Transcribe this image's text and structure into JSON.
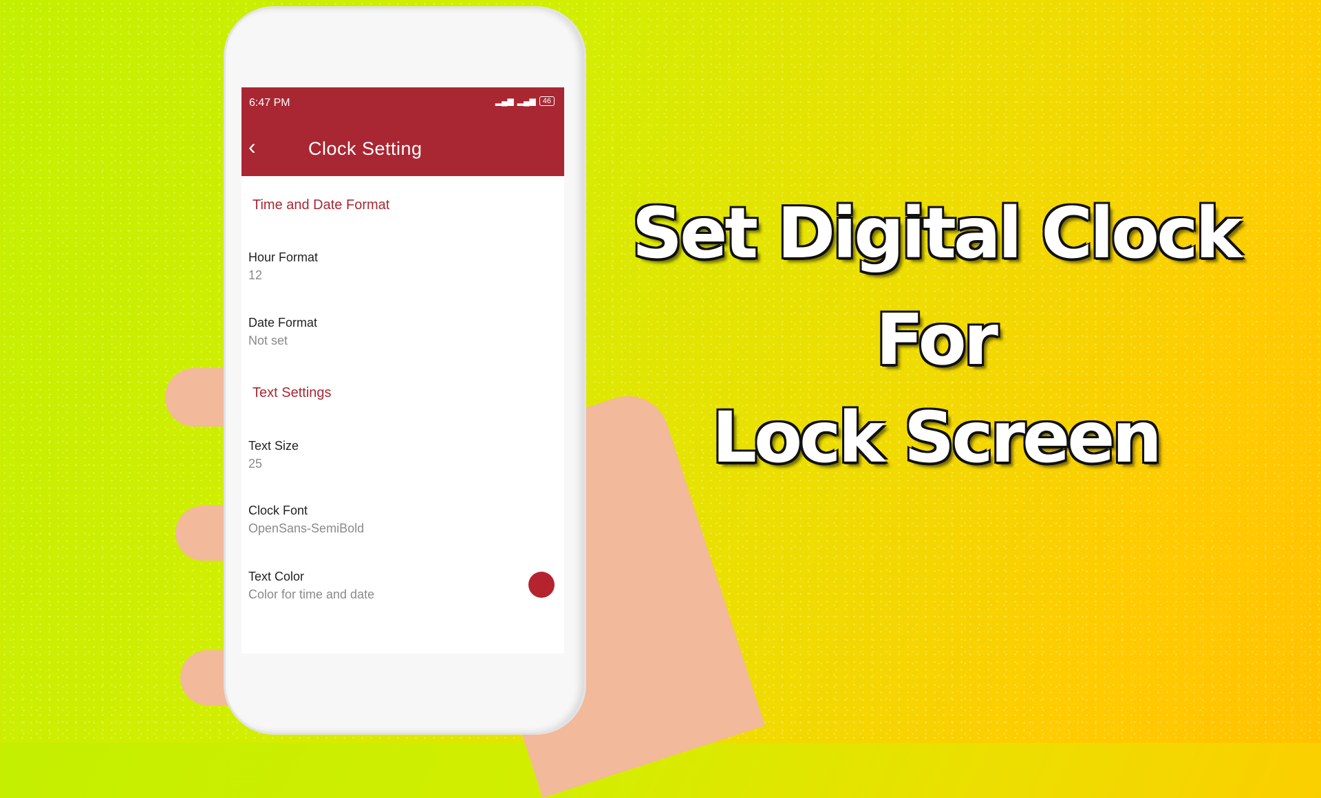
{
  "status_bar": {
    "time": "6:47 PM",
    "battery": "46"
  },
  "app_bar": {
    "title": "Clock Setting"
  },
  "sections": [
    {
      "title": "Time and Date Format",
      "items": [
        {
          "label": "Hour Format",
          "value": "12"
        },
        {
          "label": "Date Format",
          "value": "Not set"
        }
      ]
    },
    {
      "title": "Text Settings",
      "items": [
        {
          "label": "Text Size",
          "value": "25"
        },
        {
          "label": "Clock Font",
          "value": "OpenSans-SemiBold"
        },
        {
          "label": "Text Color",
          "value": "Color for time and date"
        }
      ]
    }
  ],
  "text_color_swatch": "#b5232f",
  "headline": {
    "line1": "Set Digital Clock",
    "line2": "For",
    "line3": "Lock Screen"
  },
  "accent": "#a92732"
}
